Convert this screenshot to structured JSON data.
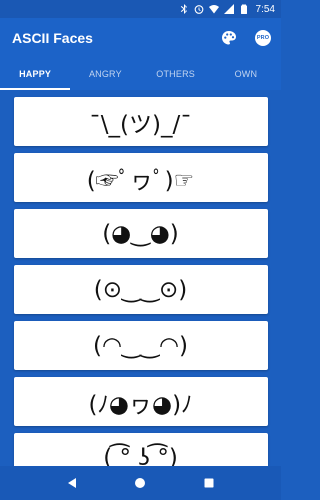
{
  "status_bar": {
    "time": "7:54",
    "icons": [
      "bluetooth-icon",
      "alarm-icon",
      "wifi-icon",
      "signal-icon",
      "battery-icon"
    ]
  },
  "app": {
    "title": "ASCII Faces",
    "actions": [
      "palette-icon",
      "pro-badge-icon"
    ],
    "pro_label": "PRO"
  },
  "tabs": [
    {
      "label": "HAPPY",
      "active": true
    },
    {
      "label": "ANGRY",
      "active": false
    },
    {
      "label": "OTHERS",
      "active": false
    },
    {
      "label": "OWN",
      "active": false
    }
  ],
  "faces": [
    "¯\\_(ツ)_/¯",
    "(☞ﾟヮﾟ)☞",
    "(◕‿◕)",
    "(⊙‿‿⊙)",
    "(◠‿‿◠)",
    "(ﾉ◕ヮ◕)ﾉ",
    "( ͡° ͜ʖ ͡°)"
  ],
  "nav_bar": {
    "buttons": [
      "back-icon",
      "home-icon",
      "recents-icon"
    ]
  },
  "colors": {
    "app_bar": "#1c63c8",
    "background": "#1c5fbf",
    "card": "#ffffff"
  }
}
